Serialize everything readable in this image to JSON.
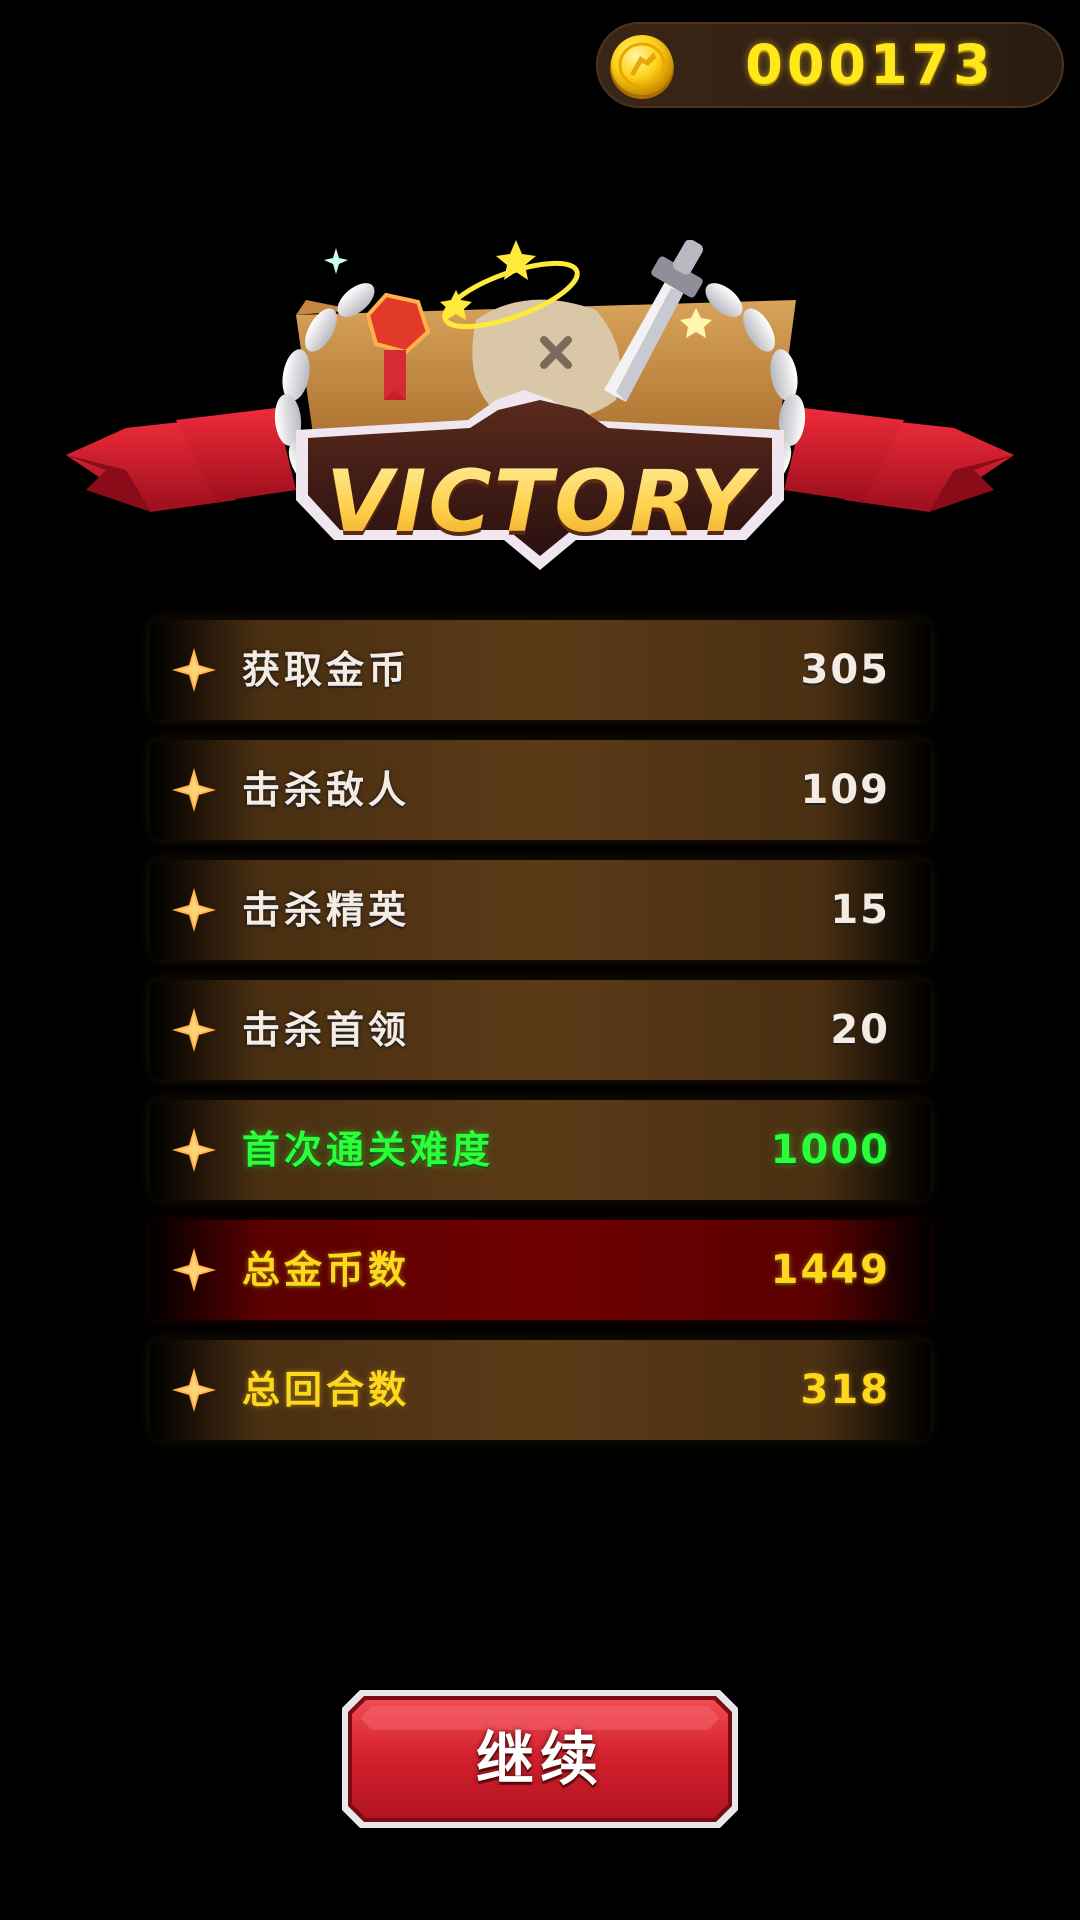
{
  "header": {
    "coin_count": "000173",
    "coin_icon": "gold-coin-icon"
  },
  "emblem": {
    "title": "VICTORY",
    "ribbon_color": "#d11a2a",
    "laurel_color": "#e6e6e6"
  },
  "stats": [
    {
      "label": "获取金币",
      "value": "305",
      "style": "default"
    },
    {
      "label": "击杀敌人",
      "value": "109",
      "style": "default"
    },
    {
      "label": "击杀精英",
      "value": "15",
      "style": "default"
    },
    {
      "label": "击杀首领",
      "value": "20",
      "style": "default"
    },
    {
      "label": "首次通关难度",
      "value": "1000",
      "style": "green"
    },
    {
      "label": "总金币数",
      "value": "1449",
      "style": "yellow-red"
    },
    {
      "label": "总回合数",
      "value": "318",
      "style": "yellow"
    }
  ],
  "continue_button": {
    "label": "继续"
  },
  "colors": {
    "background": "#000000",
    "coin_text": "#ffe81a",
    "row_brown": "#5b3a17",
    "row_red": "#6e0000",
    "highlight_green": "#2aff3a",
    "highlight_yellow": "#ffd81e",
    "button_red": "#d3202e"
  }
}
